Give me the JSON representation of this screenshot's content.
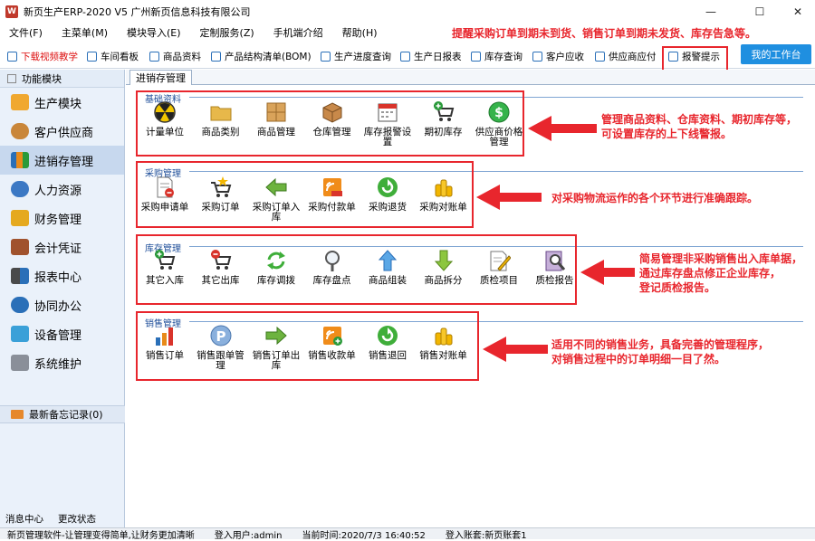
{
  "window": {
    "title": "新页生产ERP-2020 V5 广州新页信息科技有限公司",
    "controls": {
      "minimize": "—",
      "maximize": "☐",
      "close": "✕"
    }
  },
  "menubar": [
    "文件(F)",
    "主菜单(M)",
    "模块导入(E)",
    "定制服务(Z)",
    "手机端介绍",
    "帮助(H)"
  ],
  "top_note": "提醒采购订单到期未到货、销售订单到期未发货、库存告急等。",
  "toolbar": {
    "items": [
      "下载视频教学",
      "车间看板",
      "商品资料",
      "产品结构清单(BOM)",
      "生产进度查询",
      "生产日报表",
      "库存查询",
      "客户应收",
      "供应商应付",
      "报警提示"
    ],
    "workbench": "我的工作台"
  },
  "sidebar": {
    "header": "功能模块",
    "items": [
      "生产模块",
      "客户供应商",
      "进销存管理",
      "人力资源",
      "财务管理",
      "会计凭证",
      "报表中心",
      "协同办公",
      "设备管理",
      "系统维护"
    ],
    "memo": "最新备忘记录(0)",
    "bottom": [
      "消息中心",
      "更改状态"
    ]
  },
  "tab": "进销存管理",
  "sections": [
    {
      "title": "基础资料",
      "items": [
        {
          "label": "计量单位",
          "icon": "radiation-icon"
        },
        {
          "label": "商品类别",
          "icon": "folder-icon"
        },
        {
          "label": "商品管理",
          "icon": "box-grid-icon"
        },
        {
          "label": "仓库管理",
          "icon": "warehouse-box-icon"
        },
        {
          "label": "库存报警设置",
          "icon": "calendar-icon"
        },
        {
          "label": "期初库存",
          "icon": "cart-plus-icon"
        },
        {
          "label": "供应商价格管理",
          "icon": "dollar-icon"
        }
      ]
    },
    {
      "title": "采购管理",
      "items": [
        {
          "label": "采购申请单",
          "icon": "document-cancel-icon"
        },
        {
          "label": "采购订单",
          "icon": "cart-star-icon"
        },
        {
          "label": "采购订单入库",
          "icon": "arrow-left-icon"
        },
        {
          "label": "采购付款单",
          "icon": "payment-icon"
        },
        {
          "label": "采购退货",
          "icon": "refresh-green-icon"
        },
        {
          "label": "采购对账单",
          "icon": "coins-icon"
        }
      ]
    },
    {
      "title": "库存管理",
      "items": [
        {
          "label": "其它入库",
          "icon": "cart-plus-icon"
        },
        {
          "label": "其它出库",
          "icon": "cart-minus-icon"
        },
        {
          "label": "库存调拨",
          "icon": "recycle-icon"
        },
        {
          "label": "库存盘点",
          "icon": "magnifier-icon"
        },
        {
          "label": "商品组装",
          "icon": "arrow-up-icon"
        },
        {
          "label": "商品拆分",
          "icon": "arrow-down-icon"
        },
        {
          "label": "质检项目",
          "icon": "pencil-note-icon"
        },
        {
          "label": "质检报告",
          "icon": "report-magnifier-icon"
        }
      ]
    },
    {
      "title": "销售管理",
      "items": [
        {
          "label": "销售订单",
          "icon": "bar-chart-icon"
        },
        {
          "label": "销售跟单管理",
          "icon": "parking-icon"
        },
        {
          "label": "销售订单出库",
          "icon": "arrow-right-icon"
        },
        {
          "label": "销售收款单",
          "icon": "receipt-icon"
        },
        {
          "label": "销售退回",
          "icon": "refresh-green-icon"
        },
        {
          "label": "销售对账单",
          "icon": "coins-icon"
        }
      ]
    }
  ],
  "notes": [
    [
      "管理商品资料、仓库资料、期初库存等，",
      "可设置库存的上下线警报。"
    ],
    [
      "对采购物流运作的各个环节进行准确跟踪。"
    ],
    [
      "简易管理非采购销售出入库单据，",
      "通过库存盘点修正企业库存，",
      "登记质检报告。"
    ],
    [
      "适用不同的销售业务，具备完善的管理程序，",
      "对销售过程中的订单明细一目了然。"
    ]
  ],
  "status": [
    "新页管理软件-让管理变得简单,让财务更加清晰",
    "登入用户:admin",
    "当前时间:2020/7/3 16:40:52",
    "登入账套:新页账套1"
  ],
  "colors": {
    "accent": "#1f8fe0",
    "annotation": "#e8262d",
    "sidebar_bg": "#eaf1fa"
  }
}
